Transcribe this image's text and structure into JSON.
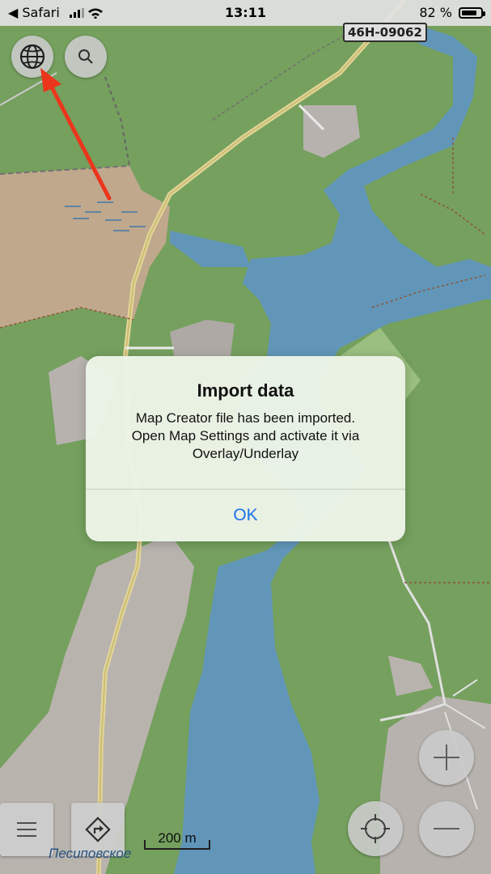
{
  "status_bar": {
    "back_app": "◀ Safari",
    "time": "13:11",
    "battery_percent": "82 %",
    "battery_level": 0.82,
    "signal_bars": 3
  },
  "map": {
    "road_sign": "46H-09062",
    "scale_label": "200 m",
    "water_label": "Песиповское"
  },
  "controls": {
    "globe_icon": "globe-icon",
    "search_icon": "search-icon",
    "menu_icon": "menu-icon",
    "route_icon": "route-icon",
    "locate_icon": "crosshair-icon",
    "zoom_in_icon": "plus-icon",
    "zoom_out_icon": "minus-icon"
  },
  "dialog": {
    "title": "Import data",
    "message": "Map Creator file has been imported.\nOpen Map Settings and activate it via\nOverlay/Underlay",
    "ok_label": "OK"
  },
  "colors": {
    "accent": "#1a73e8",
    "arrow": "#ff3b1f",
    "water": "#6aa3c9",
    "forest": "#7fae66"
  }
}
